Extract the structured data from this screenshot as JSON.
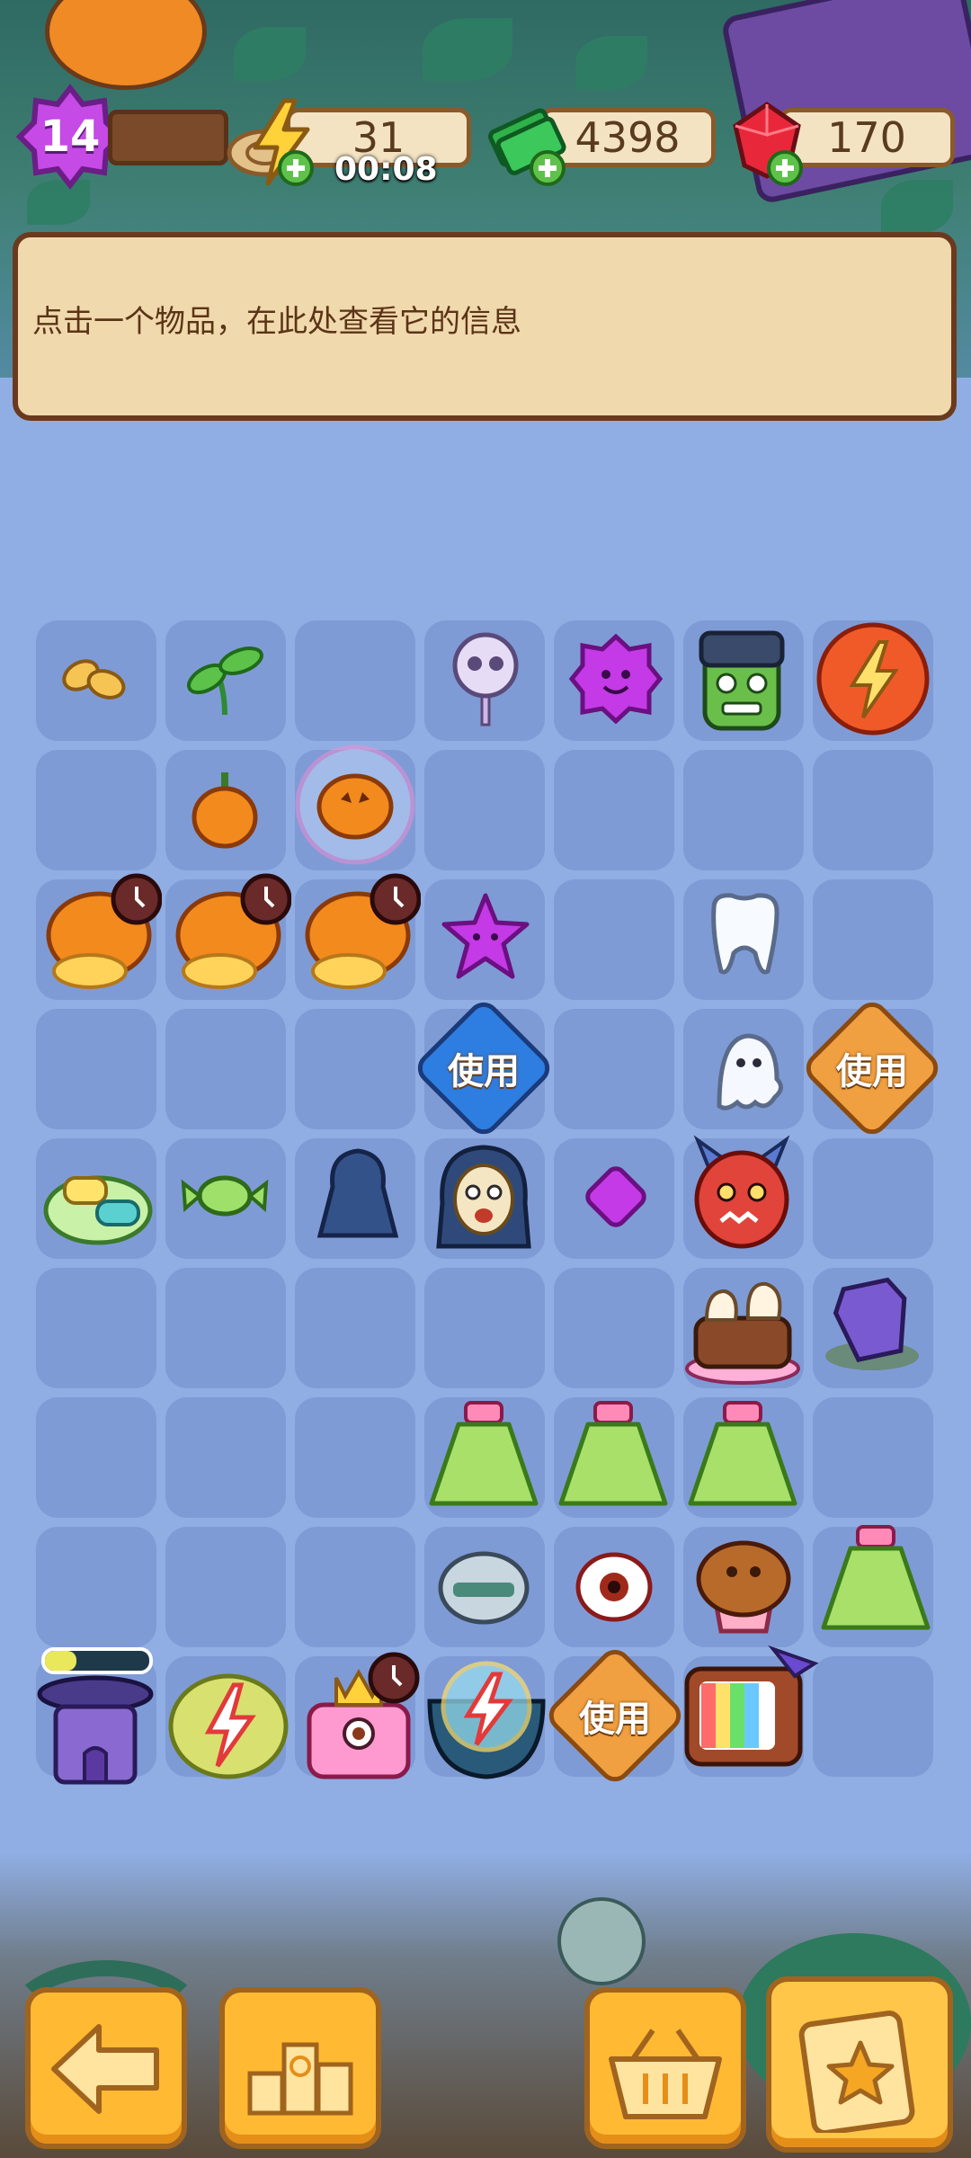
{
  "hud": {
    "level": "14",
    "energy": "31",
    "energy_timer": "00:08",
    "cash": "4398",
    "gems": "170"
  },
  "info_panel": {
    "text": "点击一个物品，在此处查看它的信息"
  },
  "board": {
    "use_label": "使用"
  },
  "icons": {
    "level": "star-badge-icon",
    "energy": "lightning-icon",
    "cash": "cash-stack-icon",
    "gems": "ruby-icon",
    "back": "arrow-left-icon",
    "leaderboard": "podium-icon",
    "shop": "basket-icon",
    "tasks": "clipboard-star-icon"
  },
  "colors": {
    "board_bg": "#93b0e6",
    "cell_bg": "#7f9bd6",
    "panel_bg": "#f0d9ad",
    "button_bg": "#ffb933"
  }
}
